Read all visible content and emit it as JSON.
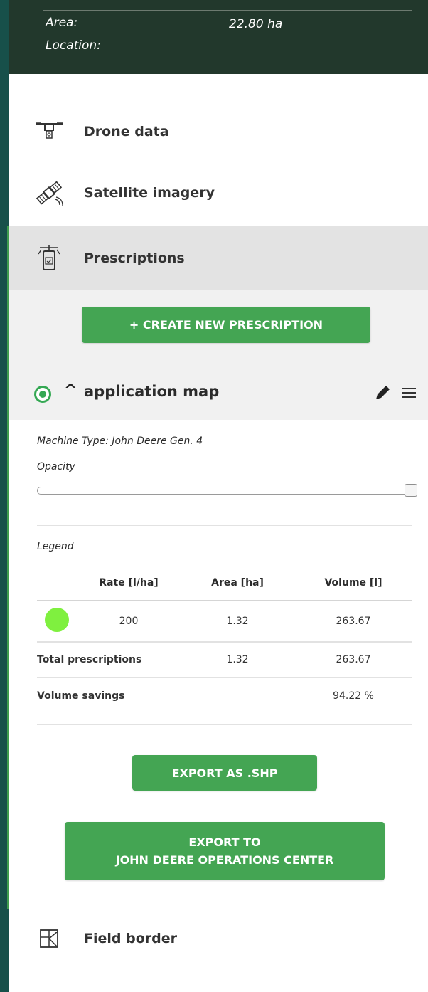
{
  "header": {
    "area_label": "Area:",
    "area_value": "22.80 ha",
    "location_label": "Location:"
  },
  "nav": {
    "drone": "Drone data",
    "satellite": "Satellite imagery",
    "prescriptions": "Prescriptions",
    "field_border": "Field border"
  },
  "prescriptions": {
    "create_button": "+ CREATE NEW PRESCRIPTION",
    "map_name": "application map",
    "machine_type": "Machine Type: John Deere Gen. 4",
    "opacity_label": "Opacity",
    "opacity_value": 1.0,
    "legend_label": "Legend",
    "table": {
      "headers": [
        "Rate [l/ha]",
        "Area [ha]",
        "Volume [l]"
      ],
      "rows": [
        {
          "color": "#7ff03f",
          "rate": "200",
          "area": "1.32",
          "volume": "263.67"
        }
      ],
      "total_label": "Total prescriptions",
      "total_area": "1.32",
      "total_volume": "263.67",
      "savings_label": "Volume savings",
      "savings_value": "94.22 %"
    },
    "export_shp": "EXPORT AS .SHP",
    "export_jd_line1": "EXPORT TO",
    "export_jd_line2": "JOHN DEERE OPERATIONS CENTER"
  },
  "colors": {
    "accent_green": "#44a553",
    "header_bg": "#22382c",
    "page_bg": "#17504a"
  }
}
